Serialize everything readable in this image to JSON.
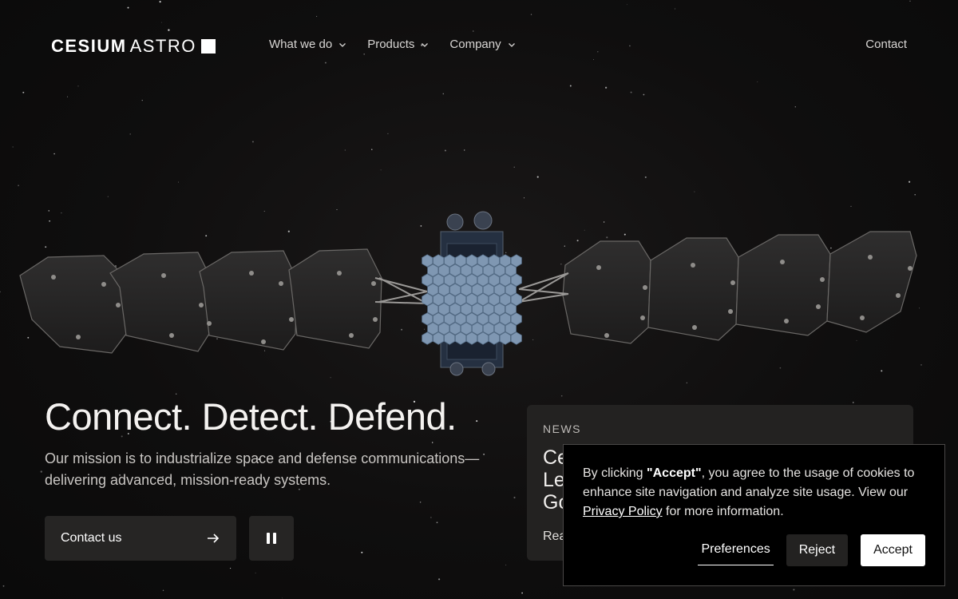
{
  "brand": {
    "name_bold": "CESIUM",
    "name_light": "ASTRO"
  },
  "nav": {
    "items": [
      {
        "label": "What we do"
      },
      {
        "label": "Products"
      },
      {
        "label": "Company"
      }
    ],
    "contact_label": "Contact"
  },
  "hero": {
    "title": "Connect. Detect. Defend.",
    "subtitle": "Our mission is to industrialize space and defense communications—delivering advanced, mission-ready systems.",
    "contact_button": "Contact us"
  },
  "news": {
    "label": "NEWS",
    "title_fragment_lines": [
      "Ce",
      "Le",
      "Go"
    ],
    "read_fragment": "Rea"
  },
  "cookie": {
    "text_before": "By clicking ",
    "accept_quote": "\"Accept\"",
    "text_middle": ", you agree to the usage of cookies to enhance site navigation and analyze site usage. View our ",
    "policy_link": "Privacy Policy",
    "text_after": " for more information.",
    "preferences_label": "Preferences",
    "reject_label": "Reject",
    "accept_label": "Accept"
  },
  "icons": {
    "nav_chevron": "chevron-down-icon",
    "contact_arrow": "arrow-right-icon",
    "pause": "pause-icon",
    "logo_mark": "square-icon"
  },
  "colors": {
    "background": "#0d0c0c",
    "button_dark": "#262524",
    "card": "#232221",
    "accept_bg": "#ffffff"
  }
}
